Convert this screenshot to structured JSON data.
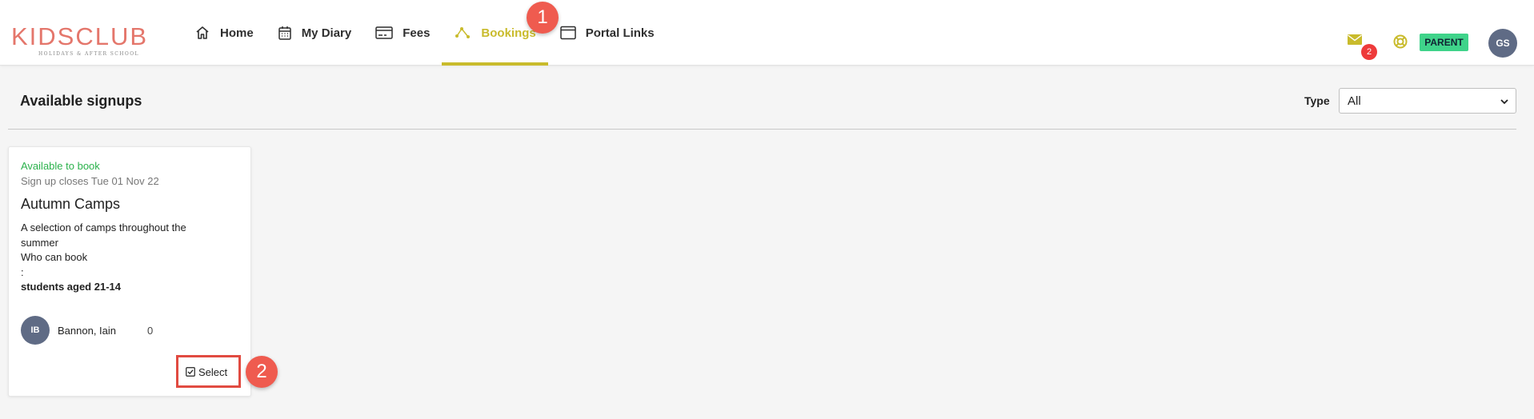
{
  "brand": {
    "name": "KIDSCLUB",
    "tagline": "HOLIDAYS & AFTER SCHOOL"
  },
  "nav": [
    {
      "label": "Home",
      "icon": "home-icon"
    },
    {
      "label": "My Diary",
      "icon": "calendar-icon"
    },
    {
      "label": "Fees",
      "icon": "credit-card-icon"
    },
    {
      "label": "Bookings",
      "icon": "bookings-icon",
      "active": true
    },
    {
      "label": "Portal Links",
      "icon": "browser-window-icon"
    }
  ],
  "header": {
    "messages_count": "2",
    "role": "PARENT",
    "user_initials": "GS"
  },
  "annotations": {
    "step1": "1",
    "step2": "2"
  },
  "page": {
    "title": "Available signups"
  },
  "filter": {
    "label": "Type",
    "value": "All"
  },
  "card": {
    "status": "Available to book",
    "closes": "Sign up closes Tue 01 Nov 22",
    "title": "Autumn Camps",
    "desc_line1": "A selection of camps throughout the",
    "desc_line2": "summer",
    "desc_line3": "Who can book",
    "desc_line4": ":",
    "desc_line5": "students aged 21-14",
    "child": {
      "initials": "IB",
      "name": "Bannon, Iain",
      "count": "0"
    },
    "select_label": "Select"
  },
  "colors": {
    "accent": "#c9bb2c",
    "brand": "#e4766b",
    "available": "#2bb24c",
    "badge_role": "#3fd38a",
    "callout": "#ef5b4f"
  }
}
